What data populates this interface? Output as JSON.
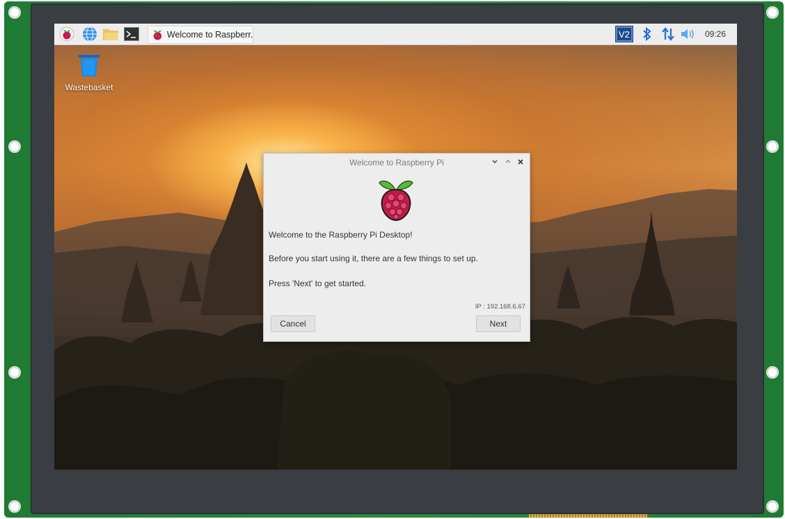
{
  "taskbar": {
    "task_title": "Welcome to Raspberr...",
    "clock": "09:26"
  },
  "tray_icons": [
    "vnc-icon",
    "bluetooth-icon",
    "network-icon",
    "volume-icon"
  ],
  "launchers": [
    "raspberry-menu-icon",
    "browser-icon",
    "file-manager-icon",
    "terminal-icon"
  ],
  "desktop": {
    "icons": [
      {
        "label": "Wastebasket",
        "icon": "trash-icon"
      }
    ]
  },
  "dialog": {
    "title": "Welcome to Raspberry Pi",
    "line1": "Welcome to the Raspberry Pi Desktop!",
    "line2": "Before you start using it, there are a few things to set up.",
    "line3": "Press 'Next' to get started.",
    "ip": "IP : 192.168.6.67",
    "cancel_label": "Cancel",
    "next_label": "Next"
  },
  "colors": {
    "pcb": "#2a8b3d",
    "bezel": "#3a3d42",
    "taskbar": "#ededed",
    "vnc_accent": "#1d4a8c",
    "bluetooth": "#1e6fd8"
  }
}
